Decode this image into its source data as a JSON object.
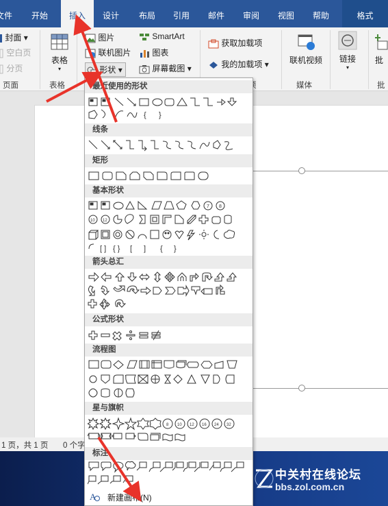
{
  "tabs": [
    {
      "label": "文件",
      "active": false
    },
    {
      "label": "开始",
      "active": false
    },
    {
      "label": "插入",
      "active": true
    },
    {
      "label": "设计",
      "active": false
    },
    {
      "label": "布局",
      "active": false
    },
    {
      "label": "引用",
      "active": false
    },
    {
      "label": "邮件",
      "active": false
    },
    {
      "label": "审阅",
      "active": false
    },
    {
      "label": "视图",
      "active": false
    },
    {
      "label": "帮助",
      "active": false
    },
    {
      "label": "格式",
      "active": false
    }
  ],
  "ribbon": {
    "pages": {
      "cover": "封面",
      "blank": "空白页",
      "break": "分页",
      "group": "页面"
    },
    "tables": {
      "table": "表格",
      "group": "表格"
    },
    "illustrations": {
      "picture": "图片",
      "online_picture": "联机图片",
      "shapes": "形状",
      "smartart": "SmartArt",
      "chart": "图表",
      "screenshot": "屏幕截图"
    },
    "addins": {
      "get": "获取加载项",
      "mine": "我的加载项",
      "group_partial": "项"
    },
    "media": {
      "online_video": "联机视频",
      "group": "媒体"
    },
    "links": {
      "link": "链接"
    },
    "comments": {
      "comment_partial": "批",
      "group_partial": "批"
    }
  },
  "dropdown": {
    "categories": {
      "recent": "最近使用的形状",
      "lines": "线条",
      "rectangles": "矩形",
      "basic": "基本形状",
      "arrows": "箭头总汇",
      "equation": "公式形状",
      "flowchart": "流程图",
      "stars": "星与旗帜",
      "callouts": "标注"
    },
    "new_canvas": "新建画布(N)"
  },
  "status": {
    "page": "1 页，共 1 页",
    "words": "0 个字"
  },
  "watermark": {
    "title": "中关村在线论坛",
    "url": "bbs.zol.com.cn"
  },
  "colors": {
    "ribbon_blue": "#2b579a",
    "arrow_red": "#e8332a"
  }
}
